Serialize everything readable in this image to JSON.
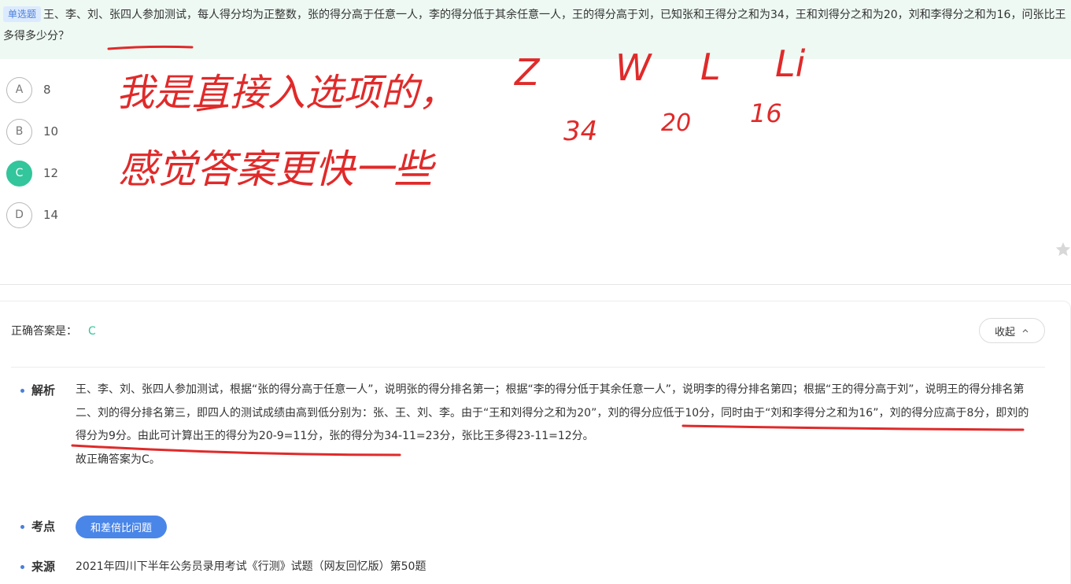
{
  "question": {
    "type_badge": "单选题",
    "text": "王、李、刘、张四人参加测试，每人得分均为正整数，张的得分高于任意一人，李的得分低于其余任意一人，王的得分高于刘，已知张和王得分之和为34，王和刘得分之和为20，刘和李得分之和为16，问张比王多得多少分？"
  },
  "options": [
    {
      "letter": "A",
      "value": "8",
      "selected": false
    },
    {
      "letter": "B",
      "value": "10",
      "selected": false
    },
    {
      "letter": "C",
      "value": "12",
      "selected": true
    },
    {
      "letter": "D",
      "value": "14",
      "selected": false
    }
  ],
  "answer": {
    "label": "正确答案是：",
    "value": "C",
    "collapse_label": "收起"
  },
  "analysis": {
    "title": "解析",
    "text": "王、李、刘、张四人参加测试，根据“张的得分高于任意一人”，说明张的得分排名第一；根据“李的得分低于其余任意一人”，说明李的得分排名第四；根据“王的得分高于刘”，说明王的得分排名第二、刘的得分排名第三，即四人的测试成绩由高到低分别为：张、王、刘、李。由于“王和刘得分之和为20”，刘的得分应低于10分，同时由于“刘和李得分之和为16”，刘的得分应高于8分，即刘的得分为9分。由此可计算出王的得分为20-9=11分，张的得分为34-11=23分，张比王多得23-11=12分。",
    "conclusion": "故正确答案为C。"
  },
  "kaodian": {
    "title": "考点",
    "tag": "和差倍比问题"
  },
  "source": {
    "title": "来源",
    "text": "2021年四川下半年公务员录用考试《行测》试题（网友回忆版）第50题"
  },
  "handwriting": {
    "line1": "我是直接入选项的，",
    "letters": [
      "Z",
      "W",
      "L",
      "Li"
    ],
    "numbers": [
      "34",
      "20",
      "16"
    ],
    "line2": "感觉答案更快一些"
  },
  "colors": {
    "accent_green": "#33c59b",
    "accent_blue": "#4a86e8",
    "annotation_red": "#e02a2a",
    "header_bg": "#eef9f3"
  },
  "icons": [
    "star-icon",
    "chevron-up-icon"
  ]
}
